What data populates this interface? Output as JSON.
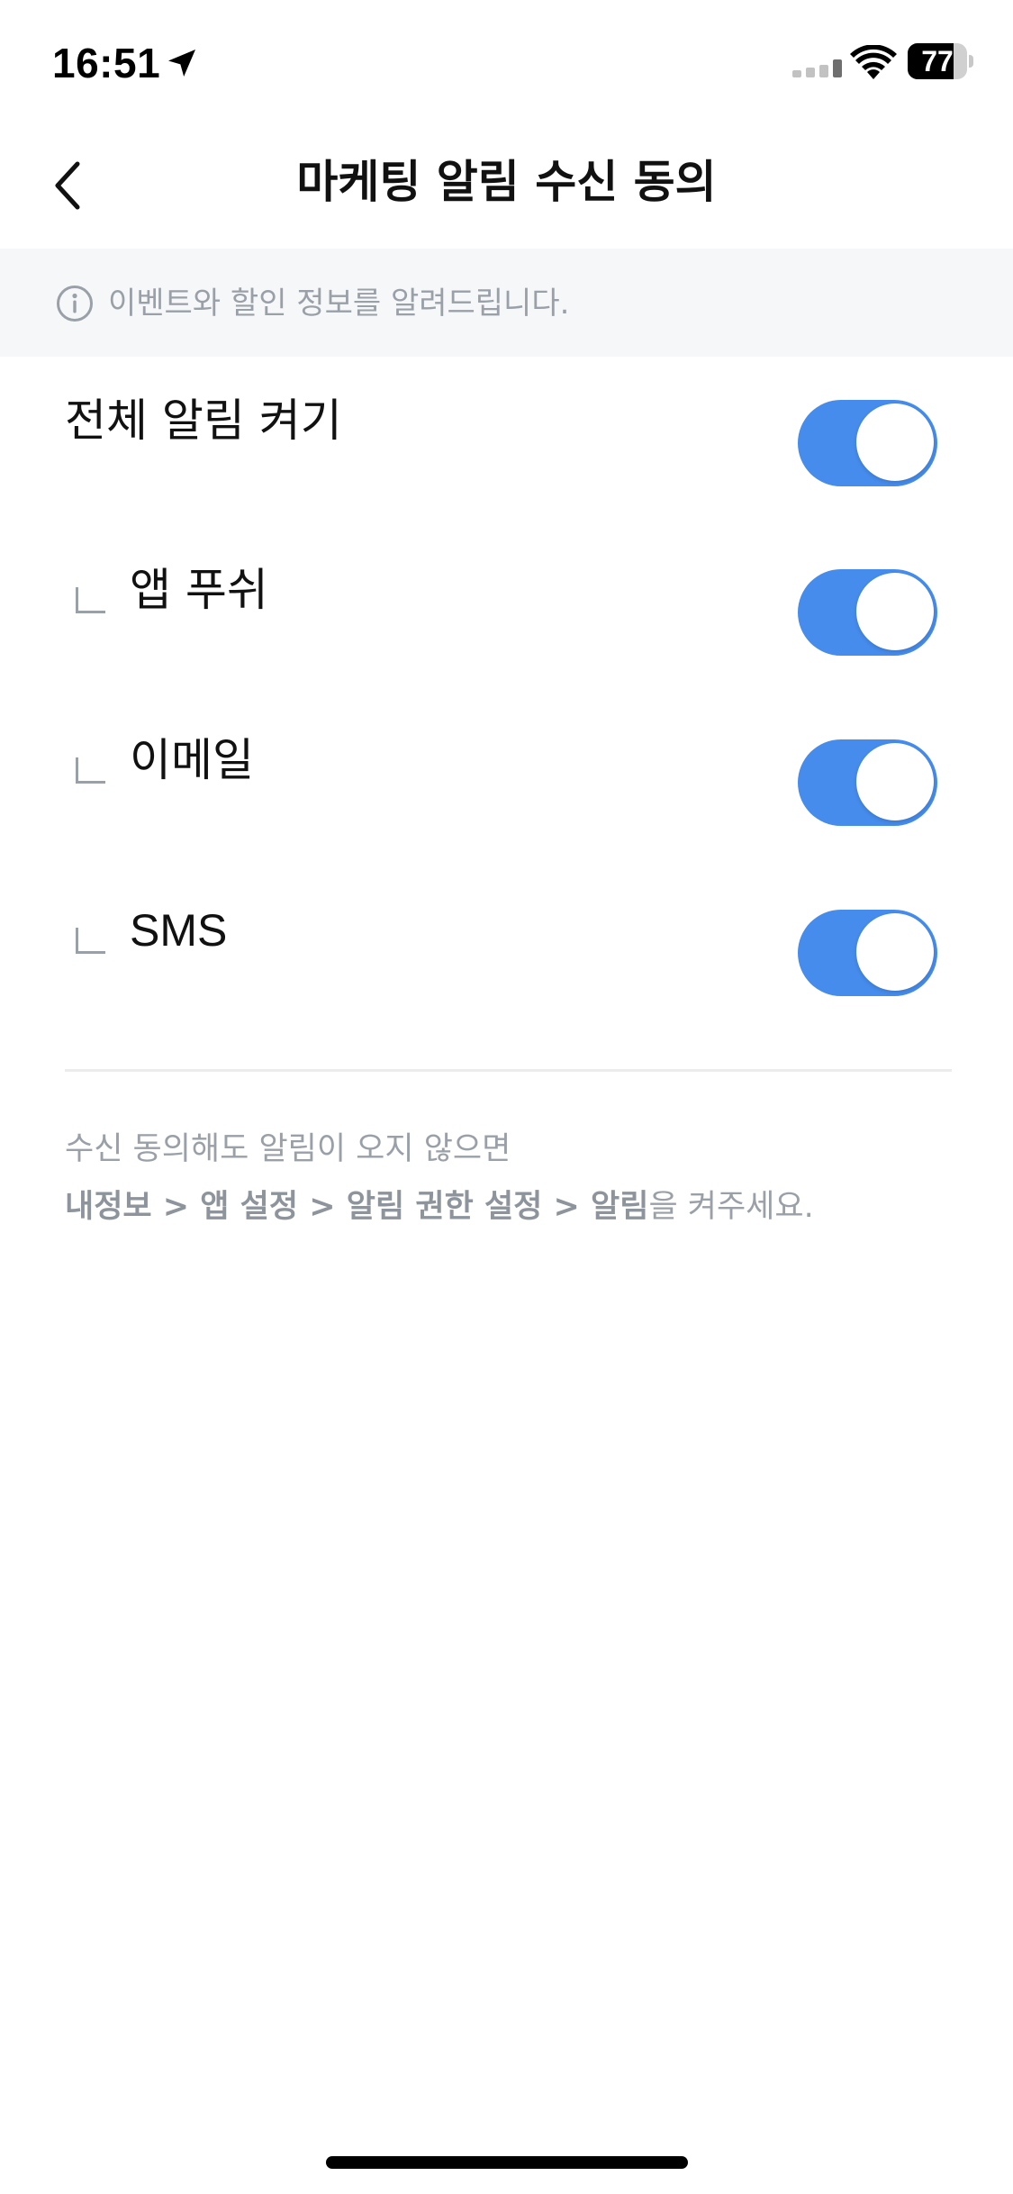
{
  "status_bar": {
    "time": "16:51",
    "battery_level": "77",
    "battery_percent": 77,
    "icons": [
      "location-arrow-icon",
      "signal-icon",
      "wifi-icon",
      "battery-icon"
    ]
  },
  "nav": {
    "back_icon": "chevron-left-icon",
    "title": "마케팅 알림 수신 동의"
  },
  "info_banner": {
    "icon": "info-circle-icon",
    "text": "이벤트와 할인 정보를 알려드립니다."
  },
  "settings": {
    "all": {
      "label": "전체 알림 켜기",
      "enabled": true
    },
    "items": [
      {
        "label": "앱 푸쉬",
        "enabled": true
      },
      {
        "label": "이메일",
        "enabled": true
      },
      {
        "label": "SMS",
        "enabled": true
      }
    ]
  },
  "help": {
    "line1": "수신 동의해도 알림이 오지 않으면",
    "path": "내정보 > 앱 설정 > 알림 권한 설정 > 알림",
    "suffix": "을 켜주세요."
  },
  "colors": {
    "toggle_on": "#468cec",
    "banner_bg": "#f6f7f9",
    "muted_text": "#9aa0a8"
  }
}
